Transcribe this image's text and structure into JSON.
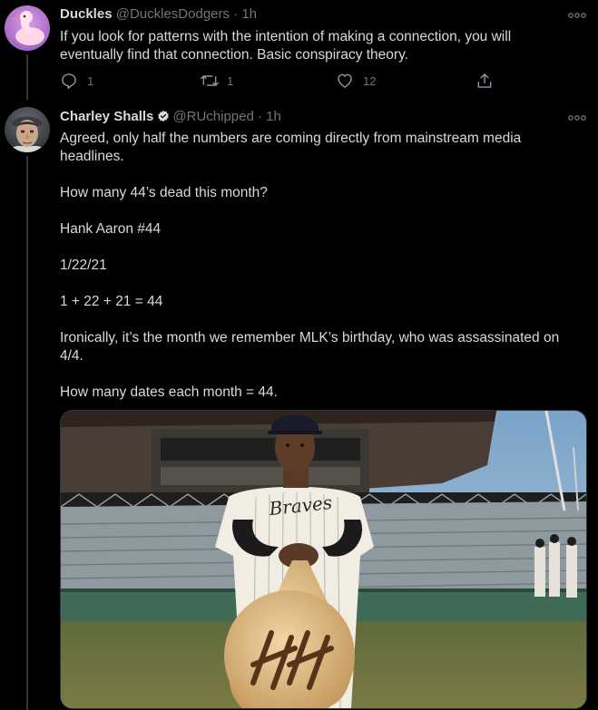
{
  "tweets": [
    {
      "name": "Duckles",
      "handle": "@DucklesDodgers",
      "separator": "·",
      "time": "1h",
      "avatar_icon": "pink-duck-avatar-icon",
      "text": "If you look for patterns with the intention of making a connection, you will eventually find that connection. Basic conspiracy theory.",
      "actions": {
        "reply_count": "1",
        "retweet_count": "1",
        "like_count": "12"
      }
    },
    {
      "name": "Charley Shalls",
      "handle": "@RUchipped",
      "separator": "·",
      "time": "1h",
      "verified_icon": "verified-badge-icon",
      "paragraphs": [
        "Agreed, only half the numbers are coming directly from mainstream media headlines.",
        "How many 44’s dead this month?",
        "Hank Aaron #44",
        "1/22/21",
        "1 + 22 + 21 = 44",
        "Ironically, it’s the month we remember MLK’s birthday, who was assassinated on 4/4.",
        "How many dates each month = 44."
      ],
      "media": {
        "jersey_text": "Braves",
        "bat_marking": "HH"
      }
    }
  ],
  "colors": {
    "background": "#000000",
    "text": "#d9d9d9",
    "secondary": "#6e767d",
    "divider": "#2f3336"
  }
}
